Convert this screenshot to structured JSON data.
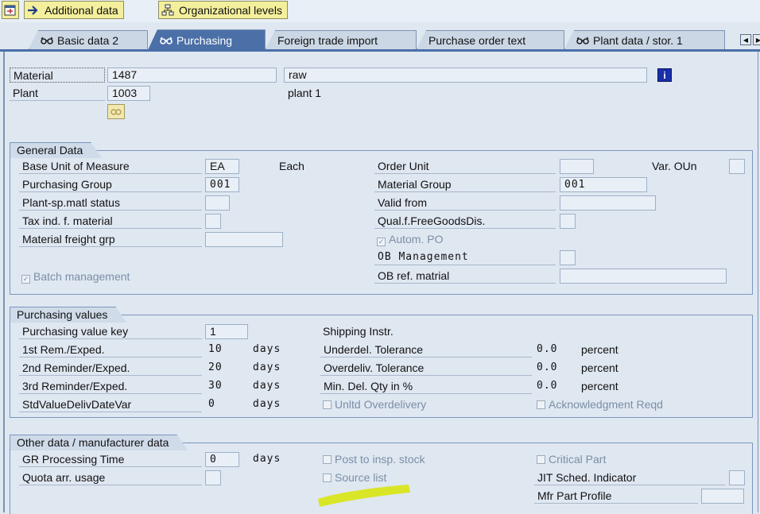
{
  "toolbar": {
    "additional_data": "Additional data",
    "organizational_levels": "Organizational levels"
  },
  "tabs": [
    {
      "label": "Basic data 2",
      "active": false
    },
    {
      "label": "Purchasing",
      "active": true
    },
    {
      "label": "Foreign trade import",
      "active": false
    },
    {
      "label": "Purchase order text",
      "active": false
    },
    {
      "label": "Plant data / stor. 1",
      "active": false
    }
  ],
  "header": {
    "material_label": "Material",
    "material_value": "1487",
    "material_desc": "raw",
    "plant_label": "Plant",
    "plant_value": "1003",
    "plant_desc": "plant 1"
  },
  "general_data": {
    "title": "General Data",
    "base_uom_label": "Base Unit of Measure",
    "base_uom_value": "EA",
    "base_uom_text": "Each",
    "purch_group_label": "Purchasing Group",
    "purch_group_value": "001",
    "plant_status_label": "Plant-sp.matl status",
    "tax_ind_label": "Tax ind. f. material",
    "freight_grp_label": "Material freight grp",
    "batch_mgmt_label": "Batch management",
    "order_unit_label": "Order Unit",
    "var_oun_label": "Var. OUn",
    "material_group_label": "Material Group",
    "material_group_value": "001",
    "valid_from_label": "Valid from",
    "qual_free_goods_label": "Qual.f.FreeGoodsDis.",
    "autom_po_label": "Autom. PO",
    "ob_mgmt_label": "OB Management",
    "ob_ref_label": "OB ref. matrial"
  },
  "purchasing_values": {
    "title": "Purchasing values",
    "value_key_label": "Purchasing value key",
    "value_key_value": "1",
    "rem1_label": "1st Rem./Exped.",
    "rem1_value": "10",
    "rem2_label": "2nd Reminder/Exped.",
    "rem2_value": "20",
    "rem3_label": "3rd Reminder/Exped.",
    "rem3_value": "30",
    "stdvalue_label": "StdValueDelivDateVar",
    "stdvalue_value": "0",
    "days": "days",
    "shipping_label": "Shipping Instr.",
    "underdel_label": "Underdel. Tolerance",
    "underdel_value": "0.0",
    "overdel_label": "Overdeliv. Tolerance",
    "overdel_value": "0.0",
    "mindel_label": "Min. Del. Qty in %",
    "mindel_value": "0.0",
    "percent": "percent",
    "unltd_label": "Unltd Overdelivery",
    "ack_label": "Acknowledgment Reqd"
  },
  "other_data": {
    "title": "Other data / manufacturer data",
    "gr_time_label": "GR Processing Time",
    "gr_time_value": "0",
    "days": "days",
    "quota_label": "Quota arr. usage",
    "post_insp_label": "Post to insp. stock",
    "source_list_label": "Source list",
    "critical_label": "Critical Part",
    "jit_label": "JIT Sched. Indicator",
    "mfr_profile_label": "Mfr Part Profile"
  },
  "colors": {
    "accent": "#4b70a8",
    "highlight": "#d8e61c"
  }
}
